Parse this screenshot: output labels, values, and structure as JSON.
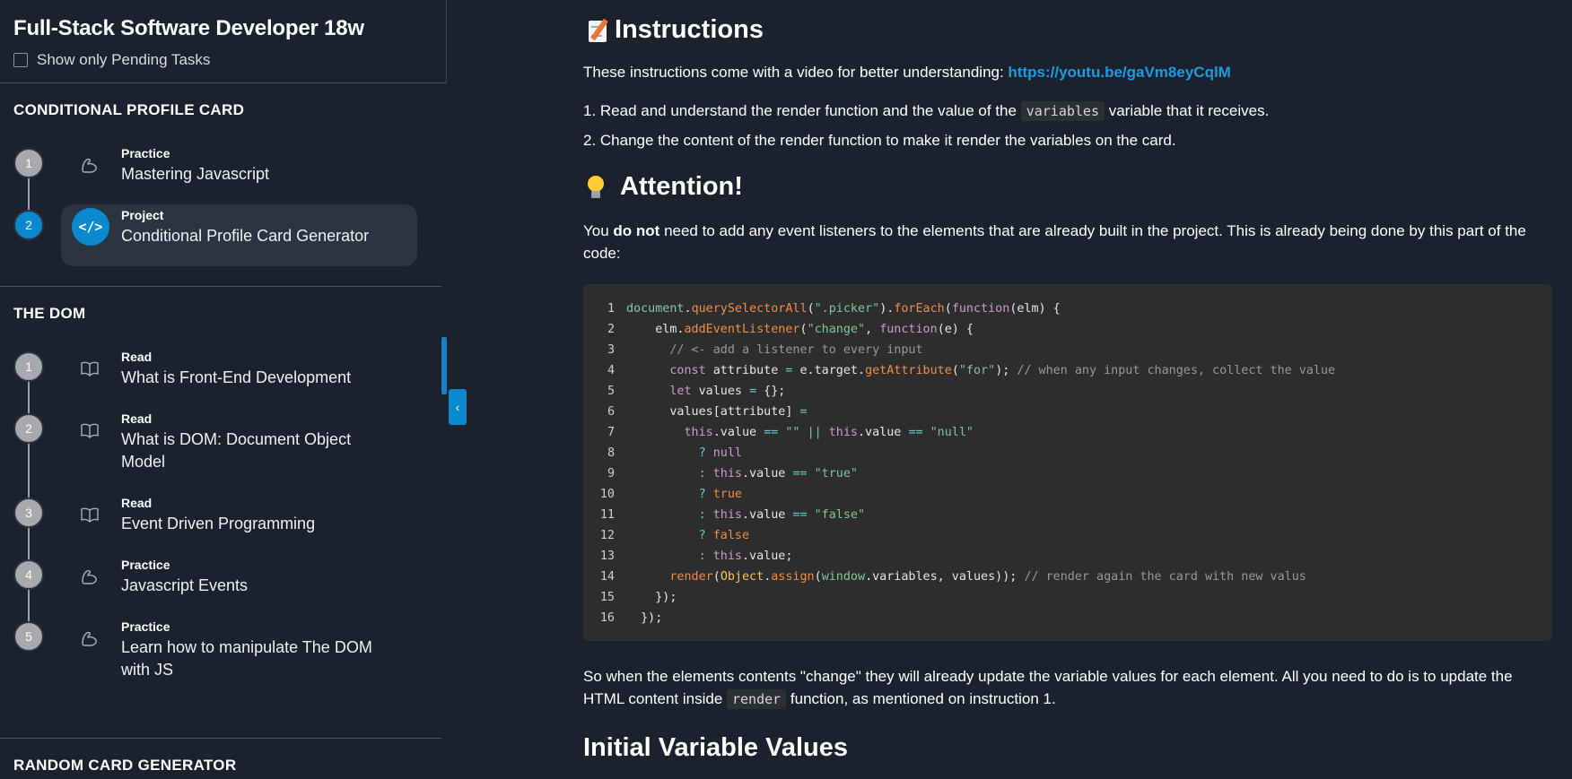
{
  "sidebar": {
    "title": "Full-Stack Software Developer 18w",
    "filter_label": "Show only Pending Tasks",
    "sections": [
      {
        "title": "CONDITIONAL PROFILE CARD",
        "steps": [
          {
            "num": "1",
            "type": "Practice",
            "name": "Mastering Javascript",
            "icon": "flexed-arm-icon",
            "active": false
          },
          {
            "num": "2",
            "type": "Project",
            "name": "Conditional Profile Card Generator",
            "icon": "code-icon",
            "icon_glyph": "</>",
            "active": true
          }
        ]
      },
      {
        "title": "THE DOM",
        "steps": [
          {
            "num": "1",
            "type": "Read",
            "name": "What is Front-End Development",
            "icon": "book-icon",
            "active": false
          },
          {
            "num": "2",
            "type": "Read",
            "name": "What is DOM: Document Object Model",
            "icon": "book-icon",
            "active": false
          },
          {
            "num": "3",
            "type": "Read",
            "name": "Event Driven Programming",
            "icon": "book-icon",
            "active": false
          },
          {
            "num": "4",
            "type": "Practice",
            "name": "Javascript Events",
            "icon": "flexed-arm-icon",
            "active": false
          },
          {
            "num": "5",
            "type": "Practice",
            "name": "Learn how to manipulate The DOM with JS",
            "icon": "flexed-arm-icon",
            "active": false
          }
        ]
      },
      {
        "title": "RANDOM CARD GENERATOR"
      }
    ]
  },
  "main": {
    "instructions_heading": "Instructions",
    "intro_text": "These instructions come with a video for better understanding: ",
    "intro_link": "https://youtu.be/gaVm8eyCqlM",
    "list": {
      "item1_pre": "Read and understand the render function and the value of the ",
      "item1_code": "variables",
      "item1_post": " variable that it receives.",
      "item2": "Change the content of the render function to make it render the variables on the card."
    },
    "attention_heading": "Attention!",
    "attention_pre": "You ",
    "attention_bold": "do not",
    "attention_post": " need to add any event listeners to the elements that are already built in the project. This is already being done by this part of the code:",
    "after_pre": "So when the elements contents \"change\" they will already update the variable values for each element. All you need to do is to update the HTML content inside ",
    "after_code": "render",
    "after_post": " function, as mentioned on instruction 1.",
    "initial_heading": "Initial Variable Values"
  },
  "code_lines": [
    {
      "n": "1",
      "tokens": [
        [
          "obj",
          "document"
        ],
        [
          "plain",
          "."
        ],
        [
          "fn",
          "querySelectorAll"
        ],
        [
          "plain",
          "("
        ],
        [
          "str",
          "\".picker\""
        ],
        [
          "plain",
          ")."
        ],
        [
          "fn",
          "forEach"
        ],
        [
          "plain",
          "("
        ],
        [
          "kw",
          "function"
        ],
        [
          "plain",
          "(elm) {"
        ]
      ]
    },
    {
      "n": "2",
      "tokens": [
        [
          "plain",
          "    elm."
        ],
        [
          "fn",
          "addEventListener"
        ],
        [
          "plain",
          "("
        ],
        [
          "str",
          "\"change\""
        ],
        [
          "plain",
          ", "
        ],
        [
          "kw",
          "function"
        ],
        [
          "plain",
          "(e) {"
        ]
      ]
    },
    {
      "n": "3",
      "tokens": [
        [
          "com",
          "      // <- add a listener to every input"
        ]
      ]
    },
    {
      "n": "4",
      "tokens": [
        [
          "plain",
          "      "
        ],
        [
          "kw",
          "const"
        ],
        [
          "plain",
          " attribute "
        ],
        [
          "op",
          "="
        ],
        [
          "plain",
          " e.target."
        ],
        [
          "fn",
          "getAttribute"
        ],
        [
          "plain",
          "("
        ],
        [
          "str",
          "\"for\""
        ],
        [
          "plain",
          "); "
        ],
        [
          "com",
          "// when any input changes, collect the value"
        ]
      ]
    },
    {
      "n": "5",
      "tokens": [
        [
          "plain",
          "      "
        ],
        [
          "kw",
          "let"
        ],
        [
          "plain",
          " values "
        ],
        [
          "op",
          "="
        ],
        [
          "plain",
          " {};"
        ]
      ]
    },
    {
      "n": "6",
      "tokens": [
        [
          "plain",
          "      values[attribute] "
        ],
        [
          "op",
          "="
        ]
      ]
    },
    {
      "n": "7",
      "tokens": [
        [
          "plain",
          "        "
        ],
        [
          "kw",
          "this"
        ],
        [
          "plain",
          ".value "
        ],
        [
          "op",
          "=="
        ],
        [
          "plain",
          " "
        ],
        [
          "str",
          "\"\""
        ],
        [
          "plain",
          " "
        ],
        [
          "op",
          "||"
        ],
        [
          "plain",
          " "
        ],
        [
          "kw",
          "this"
        ],
        [
          "plain",
          ".value "
        ],
        [
          "op",
          "=="
        ],
        [
          "plain",
          " "
        ],
        [
          "str",
          "\"null\""
        ]
      ]
    },
    {
      "n": "8",
      "tokens": [
        [
          "plain",
          "          "
        ],
        [
          "op",
          "?"
        ],
        [
          "plain",
          " "
        ],
        [
          "kw",
          "null"
        ]
      ]
    },
    {
      "n": "9",
      "tokens": [
        [
          "plain",
          "          "
        ],
        [
          "op",
          ":"
        ],
        [
          "plain",
          " "
        ],
        [
          "kw",
          "this"
        ],
        [
          "plain",
          ".value "
        ],
        [
          "op",
          "=="
        ],
        [
          "plain",
          " "
        ],
        [
          "str",
          "\"true\""
        ]
      ]
    },
    {
      "n": "10",
      "tokens": [
        [
          "plain",
          "          "
        ],
        [
          "op",
          "?"
        ],
        [
          "plain",
          " "
        ],
        [
          "bool",
          "true"
        ]
      ]
    },
    {
      "n": "11",
      "tokens": [
        [
          "plain",
          "          "
        ],
        [
          "op",
          ":"
        ],
        [
          "plain",
          " "
        ],
        [
          "kw",
          "this"
        ],
        [
          "plain",
          ".value "
        ],
        [
          "op",
          "=="
        ],
        [
          "plain",
          " "
        ],
        [
          "str",
          "\"false\""
        ]
      ]
    },
    {
      "n": "12",
      "tokens": [
        [
          "plain",
          "          "
        ],
        [
          "op",
          "?"
        ],
        [
          "plain",
          " "
        ],
        [
          "bool",
          "false"
        ]
      ]
    },
    {
      "n": "13",
      "tokens": [
        [
          "plain",
          "          "
        ],
        [
          "op",
          ":"
        ],
        [
          "plain",
          " "
        ],
        [
          "kw",
          "this"
        ],
        [
          "plain",
          ".value;"
        ]
      ]
    },
    {
      "n": "14",
      "tokens": [
        [
          "plain",
          "      "
        ],
        [
          "fn",
          "render"
        ],
        [
          "plain",
          "("
        ],
        [
          "cls",
          "Object"
        ],
        [
          "plain",
          "."
        ],
        [
          "fn",
          "assign"
        ],
        [
          "plain",
          "("
        ],
        [
          "obj",
          "window"
        ],
        [
          "plain",
          ".variables, values)); "
        ],
        [
          "com",
          "// render again the card with new valus"
        ]
      ]
    },
    {
      "n": "15",
      "tokens": [
        [
          "plain",
          "    });"
        ]
      ]
    },
    {
      "n": "16",
      "tokens": [
        [
          "plain",
          "  });"
        ]
      ]
    }
  ],
  "colors": {
    "accent": "#0b89cf",
    "link": "#1e9be0",
    "background": "#1b222e",
    "code_bg": "#2d2d2d"
  }
}
